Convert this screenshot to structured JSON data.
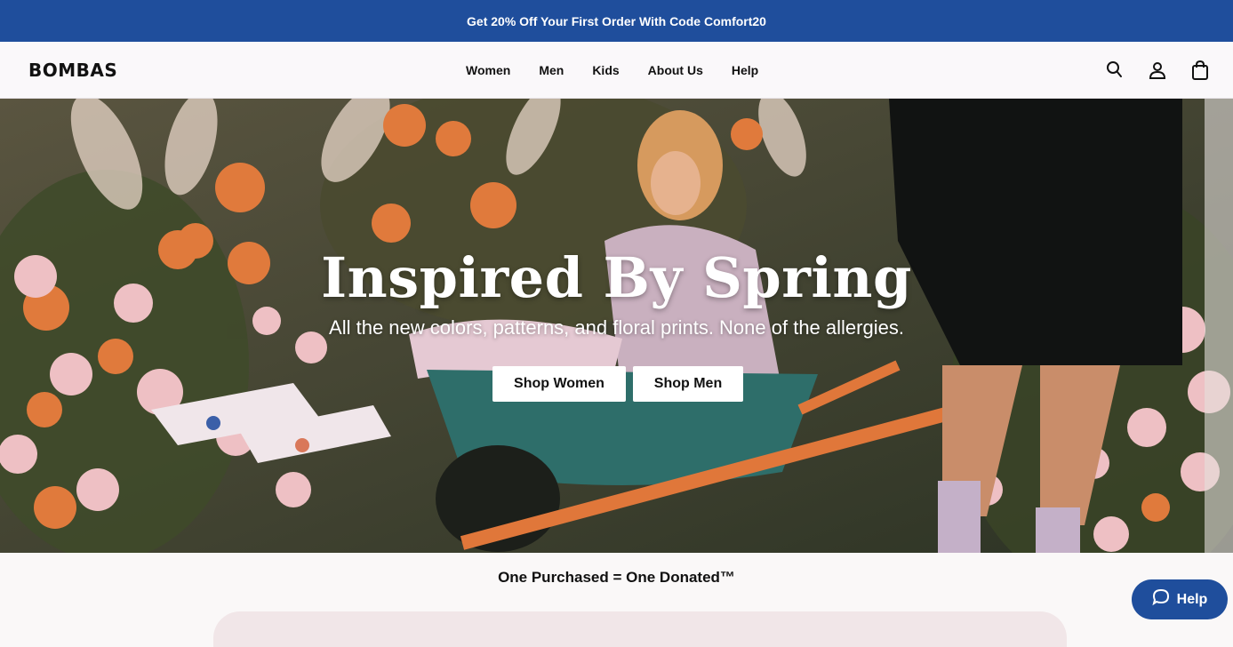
{
  "promo": {
    "text": "Get 20% Off Your First Order With Code Comfort20"
  },
  "header": {
    "logo": "BOMBAS",
    "nav": [
      "Women",
      "Men",
      "Kids",
      "About Us",
      "Help"
    ],
    "icons": [
      "search-icon",
      "account-icon",
      "bag-icon"
    ]
  },
  "hero": {
    "title": "Inspired By Spring",
    "subtitle": "All the new colors, patterns, and floral prints. None of the allergies.",
    "buttons": [
      "Shop Women",
      "Shop Men"
    ]
  },
  "donate": {
    "title": "One Purchased = One Donated™"
  },
  "help_widget": {
    "label": "Help"
  },
  "colors": {
    "brand_blue": "#1f4e9c",
    "accent_orange": "#e07a3c"
  }
}
